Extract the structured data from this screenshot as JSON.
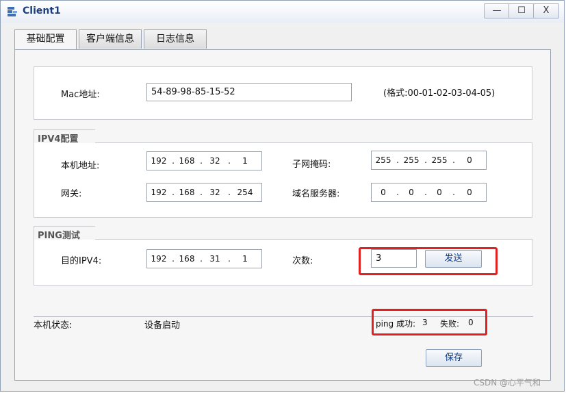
{
  "window": {
    "title": "Client1",
    "minimize": "—",
    "maximize": "☐",
    "close": "X"
  },
  "tabs": [
    "基础配置",
    "客户端信息",
    "日志信息"
  ],
  "mac": {
    "label": "Mac地址:",
    "value": "54-89-98-85-15-52",
    "format_hint": "(格式:00-01-02-03-04-05)"
  },
  "ipv4": {
    "legend": "IPV4配置",
    "local_ip_label": "本机地址:",
    "local_ip": [
      "192",
      "168",
      "32",
      "1"
    ],
    "mask_label": "子网掩码:",
    "mask": [
      "255",
      "255",
      "255",
      "0"
    ],
    "gateway_label": "网关:",
    "gateway": [
      "192",
      "168",
      "32",
      "254"
    ],
    "dns_label": "域名服务器:",
    "dns": [
      "0",
      "0",
      "0",
      "0"
    ]
  },
  "ping": {
    "legend": "PING测试",
    "target_label": "目的IPV4:",
    "target": [
      "192",
      "168",
      "31",
      "1"
    ],
    "count_label": "次数:",
    "count": "3",
    "send_label": "发送"
  },
  "status": {
    "label": "本机状态:",
    "value": "设备启动",
    "ping_success_label": "ping 成功:",
    "ping_success": "3",
    "ping_fail_label": "失败:",
    "ping_fail": "0"
  },
  "save_label": "保存",
  "watermark": "CSDN @心平气和",
  "colors": {
    "highlight": "#e22020",
    "title_text": "#1d3e7e",
    "button_text": "#0c3b86"
  }
}
